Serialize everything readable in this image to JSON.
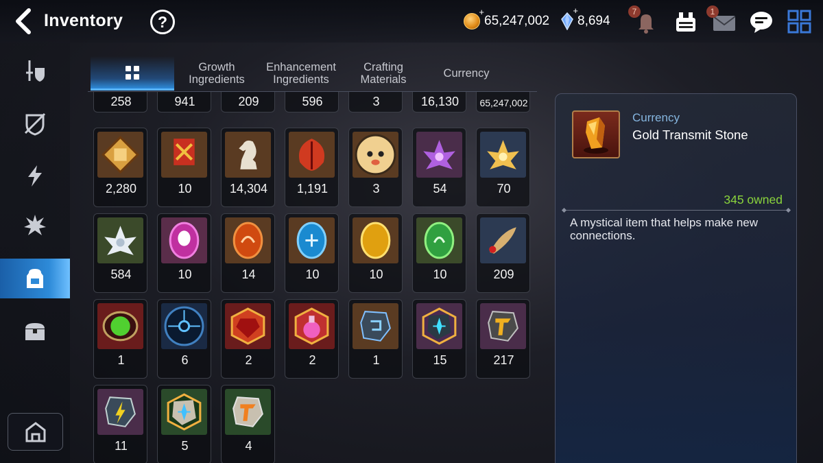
{
  "header": {
    "title": "Inventory",
    "help": "?",
    "gold": "65,247,002",
    "crystals": "8,694",
    "notifications_badge": "7",
    "mail_badge": "1",
    "icons": [
      "back-arrow-icon",
      "help-icon",
      "gold-coin-icon",
      "crystal-icon",
      "bell-icon",
      "storage-icon",
      "mail-icon",
      "chat-icon",
      "menu-grid-icon"
    ]
  },
  "sidebar": {
    "items": [
      {
        "name": "equipment",
        "icon": "sword-shield-icon"
      },
      {
        "name": "artifacts",
        "icon": "shield-crossed-icon"
      },
      {
        "name": "catalysts",
        "icon": "lightning-icon"
      },
      {
        "name": "skills",
        "icon": "burst-icon"
      },
      {
        "name": "materials",
        "icon": "backpack-icon",
        "active": true
      },
      {
        "name": "chest",
        "icon": "chest-icon"
      }
    ],
    "bottom_icon": "camp-icon"
  },
  "tabs": [
    {
      "label": "",
      "icon": "grid-icon",
      "active": true
    },
    {
      "label": "Growth Ingredients"
    },
    {
      "label": "Enhancement Ingredients"
    },
    {
      "label": "Crafting Materials"
    },
    {
      "label": "Currency"
    }
  ],
  "items_row0": [
    "258",
    "941",
    "209",
    "596",
    "3",
    "16,130",
    "65,247,002"
  ],
  "items": [
    {
      "qty": "2,280",
      "icon": "gold-fist-emblem-icon",
      "bg": "#5a3b22"
    },
    {
      "qty": "10",
      "icon": "war-banner-icon",
      "bg": "#5a3b22"
    },
    {
      "qty": "14,304",
      "icon": "chess-knight-icon",
      "bg": "#5a3b22"
    },
    {
      "qty": "1,191",
      "icon": "red-leaf-icon",
      "bg": "#5a3b22"
    },
    {
      "qty": "3",
      "icon": "mascot-face-icon",
      "bg": "#5a3b22"
    },
    {
      "qty": "54",
      "icon": "purple-lotus-icon",
      "bg": "#4a2d4a"
    },
    {
      "qty": "70",
      "icon": "gold-lotus-icon",
      "bg": "#2c3a52"
    },
    {
      "qty": "584",
      "icon": "white-lotus-icon",
      "bg": "#3b4a2a"
    },
    {
      "qty": "10",
      "icon": "pink-rune-icon",
      "bg": "#5a2d4a"
    },
    {
      "qty": "14",
      "icon": "orange-rune-icon",
      "bg": "#5a3b22"
    },
    {
      "qty": "10",
      "icon": "blue-rune-icon",
      "bg": "#5a3b22"
    },
    {
      "qty": "10",
      "icon": "yellow-rune-icon",
      "bg": "#5a3b22"
    },
    {
      "qty": "10",
      "icon": "green-rune-icon",
      "bg": "#3b4a2a"
    },
    {
      "qty": "209",
      "icon": "fish-icon",
      "bg": "#2c3a52"
    },
    {
      "qty": "1",
      "icon": "green-orb-icon",
      "bg": "#6a1c1c"
    },
    {
      "qty": "6",
      "icon": "blue-circuit-icon",
      "bg": "#1a2a44"
    },
    {
      "qty": "2",
      "icon": "red-gem-icon",
      "bg": "#6a1c1c"
    },
    {
      "qty": "2",
      "icon": "pink-potion-icon",
      "bg": "#6a1c1c"
    },
    {
      "qty": "1",
      "icon": "blue-stone-icon",
      "bg": "#5a3b22"
    },
    {
      "qty": "15",
      "icon": "cyan-star-stone-icon",
      "bg": "#4a2d4a"
    },
    {
      "qty": "217",
      "icon": "gold-transmit-stone-icon",
      "bg": "#4a2d4a"
    },
    {
      "qty": "11",
      "icon": "yellow-transmit-stone-icon",
      "bg": "#4a2d4a"
    },
    {
      "qty": "5",
      "icon": "star-stone-icon",
      "bg": "#2a4a2a"
    },
    {
      "qty": "4",
      "icon": "orange-transmit-stone-icon",
      "bg": "#2a4a2a"
    }
  ],
  "detail": {
    "category": "Currency",
    "name": "Gold Transmit Stone",
    "owned": "345 owned",
    "description": "A mystical item that helps make new connections.",
    "icon": "gold-transmit-stone-icon"
  }
}
